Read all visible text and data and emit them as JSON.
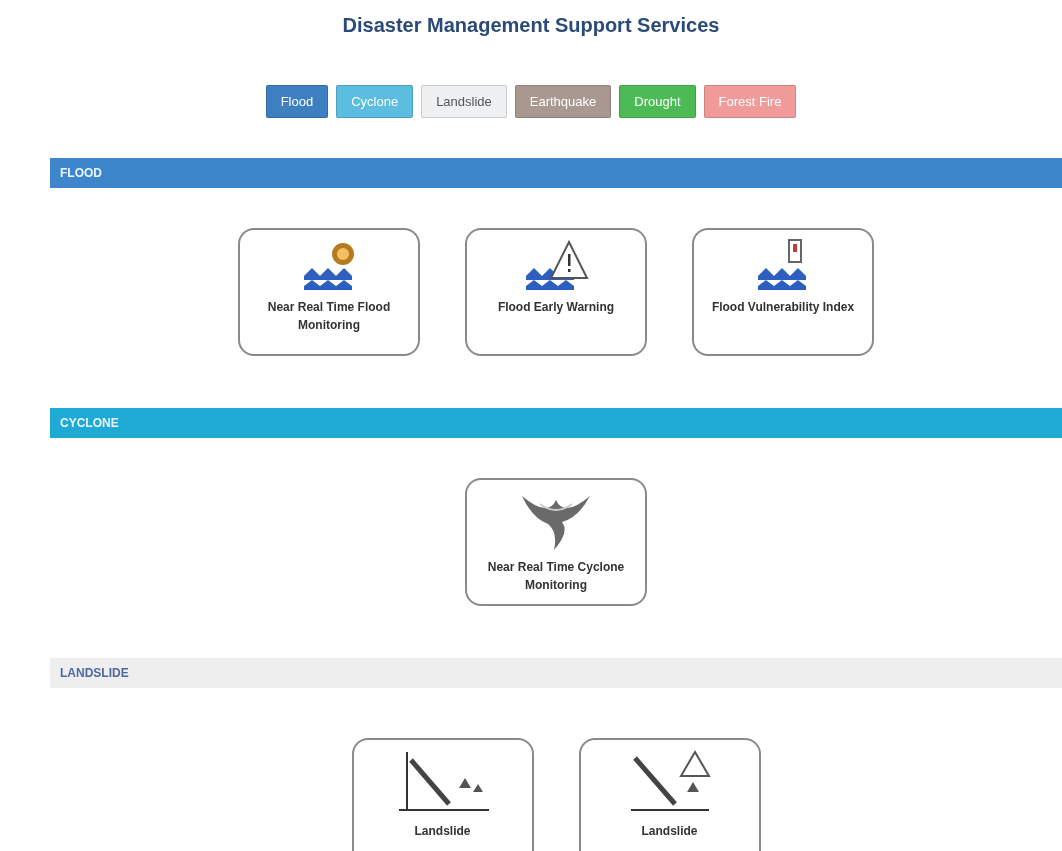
{
  "title": "Disaster Management Support Services",
  "tabs": [
    {
      "label": "Flood",
      "color": "#3d7fc0"
    },
    {
      "label": "Cyclone",
      "color": "#5bbde0"
    },
    {
      "label": "Landslide",
      "color": "#eef0f2"
    },
    {
      "label": "Earthquake",
      "color": "#a89890"
    },
    {
      "label": "Drought",
      "color": "#4cbb55"
    },
    {
      "label": "Forest Fire",
      "color": "#f09a9a"
    }
  ],
  "sections": [
    {
      "heading": "FLOOD",
      "kind": "flood",
      "color": "#3e86cc",
      "services": [
        {
          "label": "Near Real Time Flood Monitoring",
          "kind": "monitor"
        },
        {
          "label": "Flood Early Warning",
          "kind": "warning"
        },
        {
          "label": "Flood Vulnerability Index",
          "kind": "index"
        }
      ]
    },
    {
      "heading": "CYCLONE",
      "kind": "cyclone",
      "color": "#1eaad4",
      "services": [
        {
          "label": "Near Real Time Cyclone Monitoring",
          "kind": "cyclone"
        }
      ]
    },
    {
      "heading": "LANDSLIDE",
      "kind": "landslide",
      "color": "#eeeeee",
      "services": [
        {
          "label": "Landslide",
          "kind": "slope"
        },
        {
          "label": "Landslide",
          "kind": "slope-warning"
        }
      ]
    }
  ]
}
